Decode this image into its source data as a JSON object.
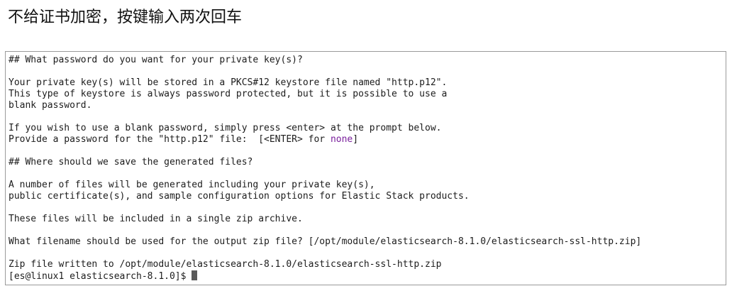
{
  "caption": "不给证书加密，按键输入两次回车",
  "terminal": {
    "l1": "## What password do you want for your private key(s)?",
    "l2": "Your private key(s) will be stored in a PKCS#12 keystore file named \"http.p12\".",
    "l3": "This type of keystore is always password protected, but it is possible to use a",
    "l4": "blank password.",
    "l5": "If you wish to use a blank password, simply press <enter> at the prompt below.",
    "l6_pre": "Provide a password for the \"http.p12\" file:  [<ENTER> for ",
    "l6_none": "none",
    "l6_post": "]",
    "l7": "## Where should we save the generated files?",
    "l8": "A number of files will be generated including your private key(s),",
    "l9": "public certificate(s), and sample configuration options for Elastic Stack products.",
    "l10": "These files will be included in a single zip archive.",
    "l11": "What filename should be used for the output zip file? [/opt/module/elasticsearch-8.1.0/elasticsearch-ssl-http.zip]",
    "l12": "Zip file written to /opt/module/elasticsearch-8.1.0/elasticsearch-ssl-http.zip",
    "prompt": "[es@linux1 elasticsearch-8.1.0]$ "
  },
  "colors": {
    "none_highlight": "#7a1f9c",
    "text": "#1c1c1c",
    "border": "#9a9a9a"
  }
}
